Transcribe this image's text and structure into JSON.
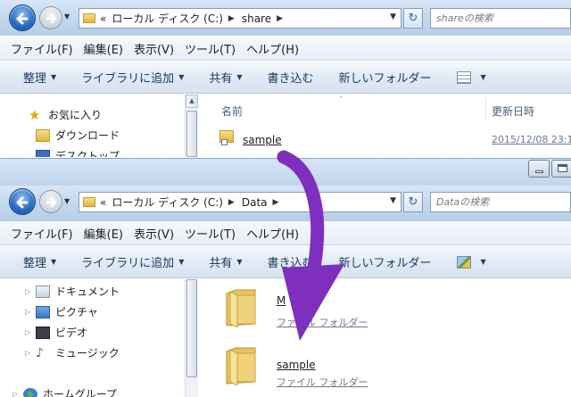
{
  "top_window": {
    "address": {
      "chevron": "«",
      "segments": [
        "ローカル ディスク (C:)",
        "share"
      ],
      "arrow": "▶"
    },
    "search_placeholder": "shareの検索",
    "refresh_glyph": "↻",
    "menu": [
      "ファイル(F)",
      "編集(E)",
      "表示(V)",
      "ツール(T)",
      "ヘルプ(H)"
    ],
    "toolbar": [
      "整理",
      "ライブラリに追加",
      "共有",
      "書き込む",
      "新しいフォルダー"
    ],
    "nav": [
      {
        "label": "お気に入り",
        "icon": "star-icon"
      },
      {
        "label": "ダウンロード",
        "icon": "download-folder-icon"
      },
      {
        "label": "デスクトップ",
        "icon": "desktop-icon"
      }
    ],
    "columns": {
      "name": "名前",
      "modified": "更新日時"
    },
    "file": {
      "name": "sample",
      "modified": "2015/12/08 23:1"
    }
  },
  "bottom_window": {
    "address": {
      "chevron": "«",
      "segments": [
        "ローカル ディスク (C:)",
        "Data"
      ],
      "arrow": "▶"
    },
    "search_placeholder": "Dataの検索",
    "refresh_glyph": "↻",
    "menu": [
      "ファイル(F)",
      "編集(E)",
      "表示(V)",
      "ツール(T)",
      "ヘルプ(H)"
    ],
    "toolbar": [
      "整理",
      "ライブラリに追加",
      "共有",
      "書き込む",
      "新しいフォルダー"
    ],
    "nav": [
      {
        "label": "ドキュメント",
        "icon": "documents-icon"
      },
      {
        "label": "ピクチャ",
        "icon": "pictures-icon"
      },
      {
        "label": "ビデオ",
        "icon": "video-icon"
      },
      {
        "label": "ミュージック",
        "icon": "music-icon"
      },
      {
        "label": "ホームグループ",
        "icon": "homegroup-icon"
      }
    ],
    "items": [
      {
        "name": "M",
        "type": "ファイル フォルダー"
      },
      {
        "name": "sample",
        "type": "ファイル フォルダー"
      }
    ]
  },
  "overlay": {
    "arrow_color": "#7f2fbf"
  }
}
